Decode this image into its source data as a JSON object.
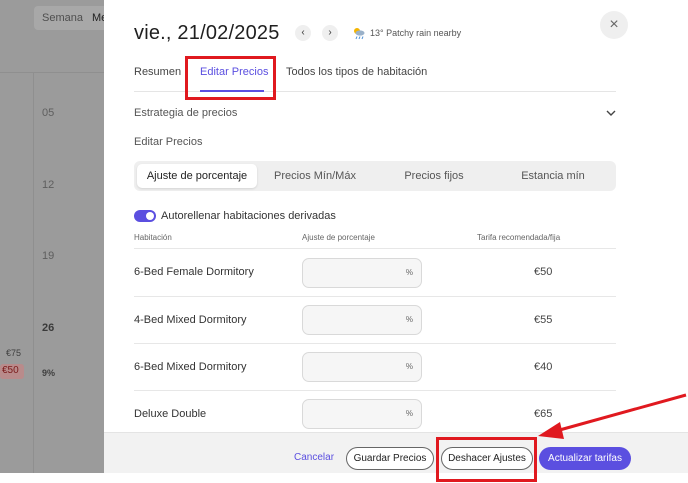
{
  "background": {
    "week_labels": [
      "Semana",
      "Me"
    ],
    "days": [
      "05",
      "12",
      "19",
      "26"
    ],
    "price_grey": "€75",
    "price_red": "€50",
    "occupancy": "9%"
  },
  "header": {
    "date_title": "vie., 21/02/2025",
    "prev_label": "‹",
    "next_label": "›",
    "weather_icon": "partly-cloudy-rain-icon",
    "weather_text": "13° Patchy rain nearby",
    "close_label": "×"
  },
  "tabs": [
    {
      "label": "Resumen",
      "active": false
    },
    {
      "label": "Editar Precios",
      "active": true
    },
    {
      "label": "Todos los tipos de habitación",
      "active": false
    }
  ],
  "pricing_strategy": {
    "label": "Estrategia de precios",
    "icon": "chevron-down-icon"
  },
  "edit_prices_label": "Editar Precios",
  "segments": [
    {
      "label": "Ajuste de porcentaje",
      "active": true
    },
    {
      "label": "Precios Mín/Máx",
      "active": false
    },
    {
      "label": "Precios fijos",
      "active": false
    },
    {
      "label": "Estancia mín",
      "active": false
    }
  ],
  "autofill": {
    "label": "Autorellenar habitaciones derivadas",
    "enabled": true
  },
  "table": {
    "headers": [
      "Habitación",
      "Ajuste de porcentaje",
      "Tarifa recomendada/fija"
    ],
    "rows": [
      {
        "room": "6-Bed Female Dormitory",
        "unit": "%",
        "rate": "€50"
      },
      {
        "room": "4-Bed Mixed Dormitory",
        "unit": "%",
        "rate": "€55"
      },
      {
        "room": "6-Bed Mixed Dormitory",
        "unit": "%",
        "rate": "€40"
      },
      {
        "room": "Deluxe Double",
        "unit": "%",
        "rate": "€65"
      }
    ]
  },
  "footer": {
    "cancel": "Cancelar",
    "save": "Guardar Precios",
    "undo": "Deshacer Ajustes",
    "update": "Actualizar tarifas"
  },
  "colors": {
    "accent": "#5b4fe0",
    "annotation_red": "#e0191f",
    "backdrop": "#9b9b9b"
  }
}
